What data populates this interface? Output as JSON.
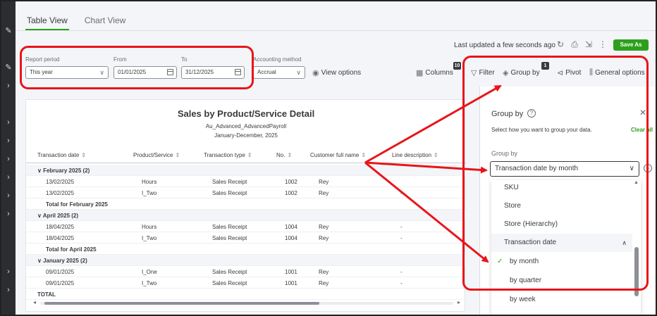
{
  "tabs": [
    {
      "label": "Table View",
      "active": true
    },
    {
      "label": "Chart View",
      "active": false
    }
  ],
  "header": {
    "last_updated": "Last updated a few seconds ago",
    "save_label": "Save As"
  },
  "filters": {
    "report_period_label": "Report period",
    "report_period_value": "This year",
    "from_label": "From",
    "from_value": "01/01/2025",
    "to_label": "To",
    "to_value": "31/12/2025",
    "accounting_label": "Accounting method",
    "accounting_value": "Accrual",
    "view_options": "View options"
  },
  "toolbar": {
    "columns_label": "Columns",
    "columns_badge": "10",
    "filter_label": "Filter",
    "group_by_label": "Group by",
    "group_by_badge": "1",
    "pivot_label": "Pivot",
    "general_options_label": "General options"
  },
  "report": {
    "title": "Sales by Product/Service Detail",
    "company": "Au_Advanced_AdvancedPayroll",
    "period": "January-December, 2025",
    "columns": [
      "Transaction date",
      "Product/Service",
      "Transaction type",
      "No.",
      "Customer full name",
      "Line description"
    ],
    "rows": [
      {
        "kind": "group",
        "label": "∨  February 2025 (2)"
      },
      {
        "kind": "data",
        "cells": [
          "13/02/2025",
          "Hours",
          "Sales Receipt",
          "1002",
          "Rey",
          ""
        ]
      },
      {
        "kind": "data",
        "cells": [
          "13/02/2025",
          "I_Two",
          "Sales Receipt",
          "1002",
          "Rey",
          "-"
        ]
      },
      {
        "kind": "total",
        "label": "Total for February 2025"
      },
      {
        "kind": "group",
        "label": "∨  April 2025 (2)"
      },
      {
        "kind": "data",
        "cells": [
          "18/04/2025",
          "Hours",
          "Sales Receipt",
          "1004",
          "Rey",
          "-"
        ]
      },
      {
        "kind": "data",
        "cells": [
          "18/04/2025",
          "I_Two",
          "Sales Receipt",
          "1004",
          "Rey",
          "-"
        ]
      },
      {
        "kind": "total",
        "label": "Total for April 2025"
      },
      {
        "kind": "group",
        "label": "∨  January 2025 (2)"
      },
      {
        "kind": "data",
        "cells": [
          "09/01/2025",
          "I_One",
          "Sales Receipt",
          "1001",
          "Rey",
          "-"
        ]
      },
      {
        "kind": "data",
        "cells": [
          "09/01/2025",
          "I_Two",
          "Sales Receipt",
          "1001",
          "Rey",
          "-"
        ]
      },
      {
        "kind": "grand",
        "label": "TOTAL"
      }
    ]
  },
  "panel": {
    "title": "Group by",
    "description": "Select how you want to group your data.",
    "clear_label": "Clear all",
    "group_by_label": "Group by",
    "selected": "Transaction date by month",
    "options": [
      {
        "label": "SKU",
        "kind": "item"
      },
      {
        "label": "Store",
        "kind": "item"
      },
      {
        "label": "Store (Hierarchy)",
        "kind": "item"
      },
      {
        "label": "Transaction date",
        "kind": "header"
      },
      {
        "label": "by month",
        "kind": "sub",
        "checked": true
      },
      {
        "label": "by quarter",
        "kind": "sub"
      },
      {
        "label": "by week",
        "kind": "sub"
      }
    ]
  },
  "colors": {
    "accent": "#2ca01c",
    "annotation": "#e8151a",
    "text": "#393a3d"
  }
}
